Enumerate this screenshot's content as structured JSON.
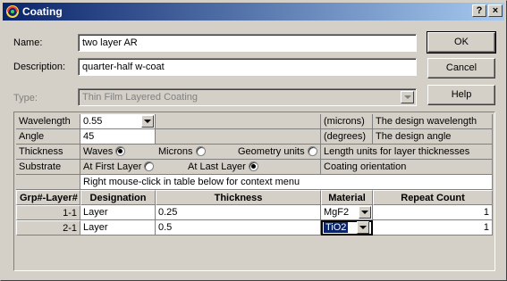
{
  "window": {
    "title": "Coating",
    "help_glyph": "?",
    "close_glyph": "×",
    "titlebar_color": "#0a246a"
  },
  "form": {
    "name_label": "Name:",
    "name_value": "two layer AR",
    "description_label": "Description:",
    "description_value": "quarter-half w-coat",
    "type_label": "Type:",
    "type_value": "Thin Film Layered Coating"
  },
  "buttons": {
    "ok": "OK",
    "cancel": "Cancel",
    "help": "Help"
  },
  "settings": {
    "wavelength_label": "Wavelength",
    "wavelength_value": "0.55",
    "wavelength_units": "(microns)",
    "wavelength_desc": "The design wavelength",
    "angle_label": "Angle",
    "angle_value": "45",
    "angle_units": "(degrees)",
    "angle_desc": "The design angle",
    "thickness_label": "Thickness",
    "thickness_opt_waves": "Waves",
    "thickness_opt_microns": "Microns",
    "thickness_opt_geometry": "Geometry units",
    "thickness_selected": "Waves",
    "thickness_desc": "Length units for layer thicknesses",
    "substrate_label": "Substrate",
    "substrate_opt_first": "At First Layer",
    "substrate_opt_last": "At Last Layer",
    "substrate_selected": "At Last Layer",
    "substrate_desc": "Coating orientation",
    "context_hint": "Right mouse-click in table below for context menu"
  },
  "layer_table": {
    "headers": {
      "grp_layer": "Grp#-Layer#",
      "designation": "Designation",
      "thickness": "Thickness",
      "material": "Material",
      "repeat_count": "Repeat Count"
    },
    "rows": [
      {
        "id": "1-1",
        "designation": "Layer",
        "thickness": "0.25",
        "material": "MgF2",
        "repeat": "1"
      },
      {
        "id": "2-1",
        "designation": "Layer",
        "thickness": "0.5",
        "material": "TiO2",
        "repeat": "1"
      }
    ]
  }
}
